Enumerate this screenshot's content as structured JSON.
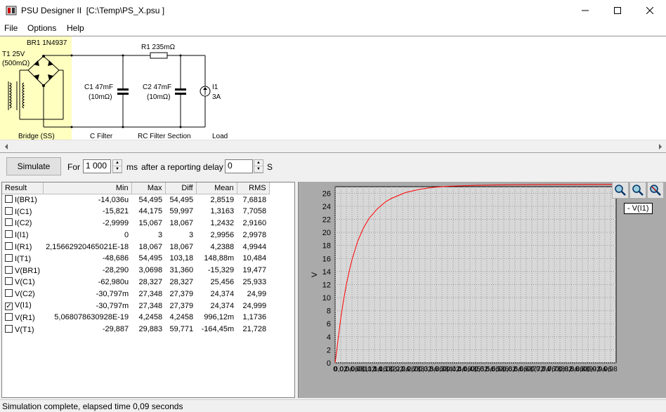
{
  "window": {
    "title": "PSU Designer II  [C:\\Temp\\PS_X.psu ]"
  },
  "menu": [
    "File",
    "Options",
    "Help"
  ],
  "schematic": {
    "transformer": {
      "name": "T1 25V",
      "resistance": "(500mΩ)"
    },
    "bridge": "BR1 1N4937",
    "c1": {
      "name": "C1 47mF",
      "esr": "(10mΩ)"
    },
    "r1": "R1 235mΩ",
    "c2": {
      "name": "C2 47mF",
      "esr": "(10mΩ)"
    },
    "load": {
      "name": "I1",
      "value": "3A"
    },
    "sections": [
      "Bridge (SS)",
      "C Filter",
      "RC Filter Section",
      "Load"
    ]
  },
  "toolbar": {
    "simulate_label": "Simulate",
    "for_label": "For",
    "duration_value": "1 000",
    "duration_unit": "ms",
    "delay_label": "after a reporting delay of",
    "delay_value": "0",
    "delay_unit": "S"
  },
  "results": {
    "columns": [
      "Result",
      "Min",
      "Max",
      "Diff",
      "Mean",
      "RMS"
    ],
    "rows": [
      {
        "checked": false,
        "name": "I(BR1)",
        "min": "-14,036u",
        "max": "54,495",
        "diff": "54,495",
        "mean": "2,8519",
        "rms": "7,6818"
      },
      {
        "checked": false,
        "name": "I(C1)",
        "min": "-15,821",
        "max": "44,175",
        "diff": "59,997",
        "mean": "1,3163",
        "rms": "7,7058"
      },
      {
        "checked": false,
        "name": "I(C2)",
        "min": "-2,9999",
        "max": "15,067",
        "diff": "18,067",
        "mean": "1,2432",
        "rms": "2,9160"
      },
      {
        "checked": false,
        "name": "I(I1)",
        "min": "0",
        "max": "3",
        "diff": "3",
        "mean": "2,9956",
        "rms": "2,9978"
      },
      {
        "checked": false,
        "name": "I(R1)",
        "min": "2,15662920465021E-18",
        "max": "18,067",
        "diff": "18,067",
        "mean": "4,2388",
        "rms": "4,9944"
      },
      {
        "checked": false,
        "name": "I(T1)",
        "min": "-48,686",
        "max": "54,495",
        "diff": "103,18",
        "mean": "148,88m",
        "rms": "10,484"
      },
      {
        "checked": false,
        "name": "V(BR1)",
        "min": "-28,290",
        "max": "3,0698",
        "diff": "31,360",
        "mean": "-15,329",
        "rms": "19,477"
      },
      {
        "checked": false,
        "name": "V(C1)",
        "min": "-62,980u",
        "max": "28,327",
        "diff": "28,327",
        "mean": "25,456",
        "rms": "25,933"
      },
      {
        "checked": false,
        "name": "V(C2)",
        "min": "-30,797m",
        "max": "27,348",
        "diff": "27,379",
        "mean": "24,374",
        "rms": "24,99"
      },
      {
        "checked": true,
        "name": "V(I1)",
        "min": "-30,797m",
        "max": "27,348",
        "diff": "27,379",
        "mean": "24,374",
        "rms": "24,999"
      },
      {
        "checked": false,
        "name": "V(R1)",
        "min": "5,068078630928E-19",
        "max": "4,2458",
        "diff": "4,2458",
        "mean": "996,12m",
        "rms": "1,1736"
      },
      {
        "checked": false,
        "name": "V(T1)",
        "min": "-29,887",
        "max": "29,883",
        "diff": "59,771",
        "mean": "-164,45m",
        "rms": "21,728"
      }
    ]
  },
  "chart_data": {
    "type": "line",
    "title": "",
    "xlabel": "",
    "ylabel": "V",
    "xlim": [
      0,
      1
    ],
    "ylim": [
      0,
      27
    ],
    "yticks": [
      0,
      2,
      4,
      6,
      8,
      10,
      12,
      14,
      16,
      18,
      20,
      22,
      24,
      26
    ],
    "xticks": [
      "0",
      "0,02",
      "0,04",
      "0,06",
      "0,08",
      "0,1",
      "0,12",
      "0,14",
      "0,16",
      "0,18",
      "0,2",
      "0,22",
      "0,24",
      "0,26",
      "0,28",
      "0,3",
      "0,32",
      "0,34",
      "0,36",
      "0,38",
      "0,4",
      "0,42",
      "0,44",
      "0,46",
      "0,48",
      "0,5",
      "0,52",
      "0,54",
      "0,56",
      "0,58",
      "0,6",
      "0,62",
      "0,64",
      "0,66",
      "0,68",
      "0,7",
      "0,72",
      "0,74",
      "0,76",
      "0,78",
      "0,8",
      "0,82",
      "0,84",
      "0,86",
      "0,88",
      "0,9",
      "0,92",
      "0,94",
      "0,96",
      "0,98"
    ],
    "grid": true,
    "legend_position": "top-right",
    "series": [
      {
        "name": "V(I1)",
        "color": "#ff0000",
        "x": [
          0,
          0.005,
          0.01,
          0.02,
          0.03,
          0.04,
          0.05,
          0.06,
          0.08,
          0.1,
          0.12,
          0.15,
          0.18,
          0.2,
          0.25,
          0.3,
          0.35,
          0.4,
          0.5,
          0.6,
          0.7,
          0.8,
          0.9,
          1.0
        ],
        "y": [
          0,
          1.6,
          3.4,
          6.8,
          9.6,
          12.0,
          14.0,
          15.8,
          18.6,
          20.6,
          22.1,
          23.6,
          24.7,
          25.2,
          26.1,
          26.6,
          26.9,
          27.05,
          27.2,
          27.28,
          27.32,
          27.34,
          27.345,
          27.348
        ]
      }
    ]
  },
  "zoom_buttons": [
    "zoom-in-icon",
    "zoom-fit-icon",
    "zoom-out-icon"
  ],
  "legend": {
    "label": "- V(I1)"
  },
  "status": {
    "text": "Simulation complete, elapsed time 0,09 seconds"
  },
  "colors": {
    "schematic_highlight": "#ffffc0",
    "trace": "#ff0000",
    "plot_bg": "#d8d8d8"
  }
}
